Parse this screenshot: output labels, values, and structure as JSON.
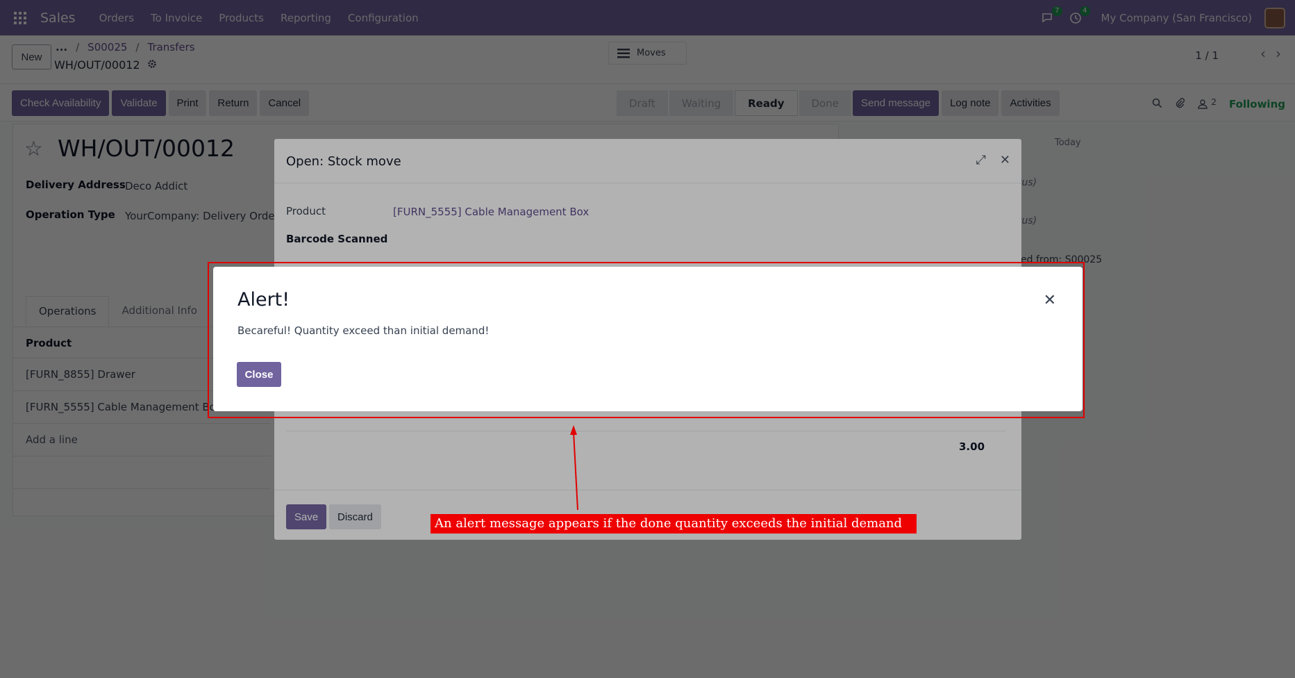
{
  "navbar": {
    "brand": "Sales",
    "menu": [
      "Orders",
      "To Invoice",
      "Products",
      "Reporting",
      "Configuration"
    ],
    "messages_badge": "7",
    "activities_badge": "4",
    "company": "My Company (San Francisco)",
    "icons": [
      "apps-grid-icon",
      "chat-icon",
      "clock-icon",
      "avatar"
    ]
  },
  "control_panel": {
    "new_label": "New",
    "breadcrumb": [
      "...",
      "S00025",
      "Transfers"
    ],
    "record_name": "WH/OUT/00012",
    "moves_label": "Moves",
    "pager": "1 / 1"
  },
  "statusbar": {
    "buttons": [
      "Check Availability",
      "Validate",
      "Print",
      "Return",
      "Cancel"
    ],
    "stages": [
      "Draft",
      "Waiting",
      "Ready",
      "Done"
    ],
    "active_stage": "Ready",
    "chatter_buttons": [
      "Send message",
      "Log note",
      "Activities"
    ],
    "followers_count": "2",
    "following_label": "Following"
  },
  "form": {
    "title": "WH/OUT/00012",
    "delivery_address_label": "Delivery Address",
    "delivery_address": "Deco Addict",
    "operation_type_label": "Operation Type",
    "operation_type": "YourCompany: Delivery Orders",
    "tabs": [
      "Operations",
      "Additional Info"
    ],
    "product_header": "Product",
    "lines": [
      "[FURN_8855] Drawer",
      "[FURN_5555] Cable Management Box"
    ],
    "add_line": "Add a line"
  },
  "chatter": {
    "today": "Today",
    "fragment1": "tus)",
    "fragment2": "tus)",
    "fragment3": "ed from: S00025"
  },
  "stock_move_dialog": {
    "title": "Open: Stock move",
    "product_label": "Product",
    "product_value": "[FURN_5555] Cable Management Box",
    "barcode_label": "Barcode Scanned",
    "total": "3.00",
    "save_label": "Save",
    "discard_label": "Discard"
  },
  "alert": {
    "title": "Alert!",
    "message": "Becareful! Quantity exceed than initial demand!",
    "close_label": "Close"
  },
  "annotation": {
    "note": "An alert message appears if the done quantity exceeds the initial demand",
    "color": "#ee0000"
  }
}
